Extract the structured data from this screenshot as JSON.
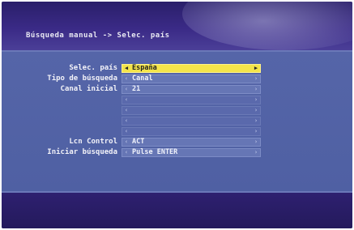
{
  "header": {
    "title": "Búsqueda manual -> Selec. país"
  },
  "rows": [
    {
      "label": "Selec. país",
      "value": "España",
      "state": "selected"
    },
    {
      "label": "Tipo de búsqueda",
      "value": "Canal",
      "state": "active"
    },
    {
      "label": "Canal inicial",
      "value": "21",
      "state": "active"
    },
    {
      "label": "",
      "value": "",
      "state": "dim"
    },
    {
      "label": "",
      "value": "",
      "state": "dim"
    },
    {
      "label": "",
      "value": "",
      "state": "dim"
    },
    {
      "label": "",
      "value": "",
      "state": "dim"
    },
    {
      "label": "Lcn Control",
      "value": "ACT",
      "state": "active"
    },
    {
      "label": "Iniciar búsqueda",
      "value": "Pulse ENTER",
      "state": "active"
    }
  ],
  "icons": {
    "left": "arrow-left-icon",
    "right": "arrow-right-icon"
  },
  "colors": {
    "selected": "#f4e44a",
    "panel": "#4f60a3",
    "header": "#2a1f6a"
  }
}
